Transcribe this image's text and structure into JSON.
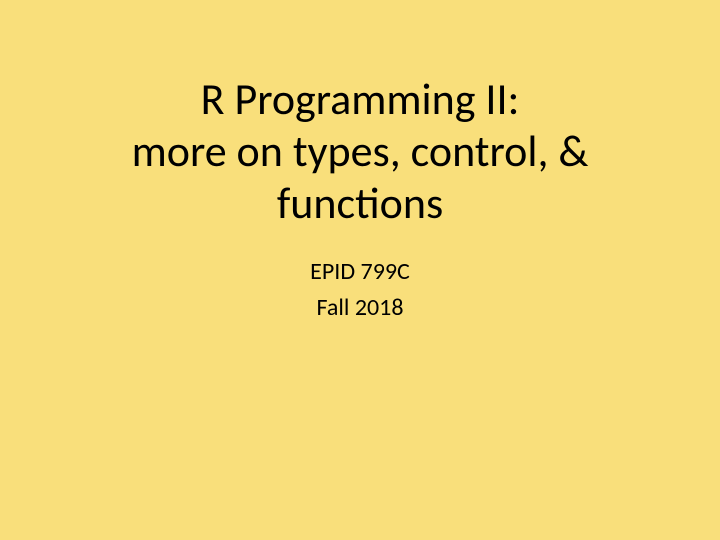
{
  "slide": {
    "title_line1": "R Programming II:",
    "title_line2": "more on types, control, &",
    "title_line3": "functions",
    "subtitle_line1": "EPID 799C",
    "subtitle_line2": "Fall 2018"
  }
}
